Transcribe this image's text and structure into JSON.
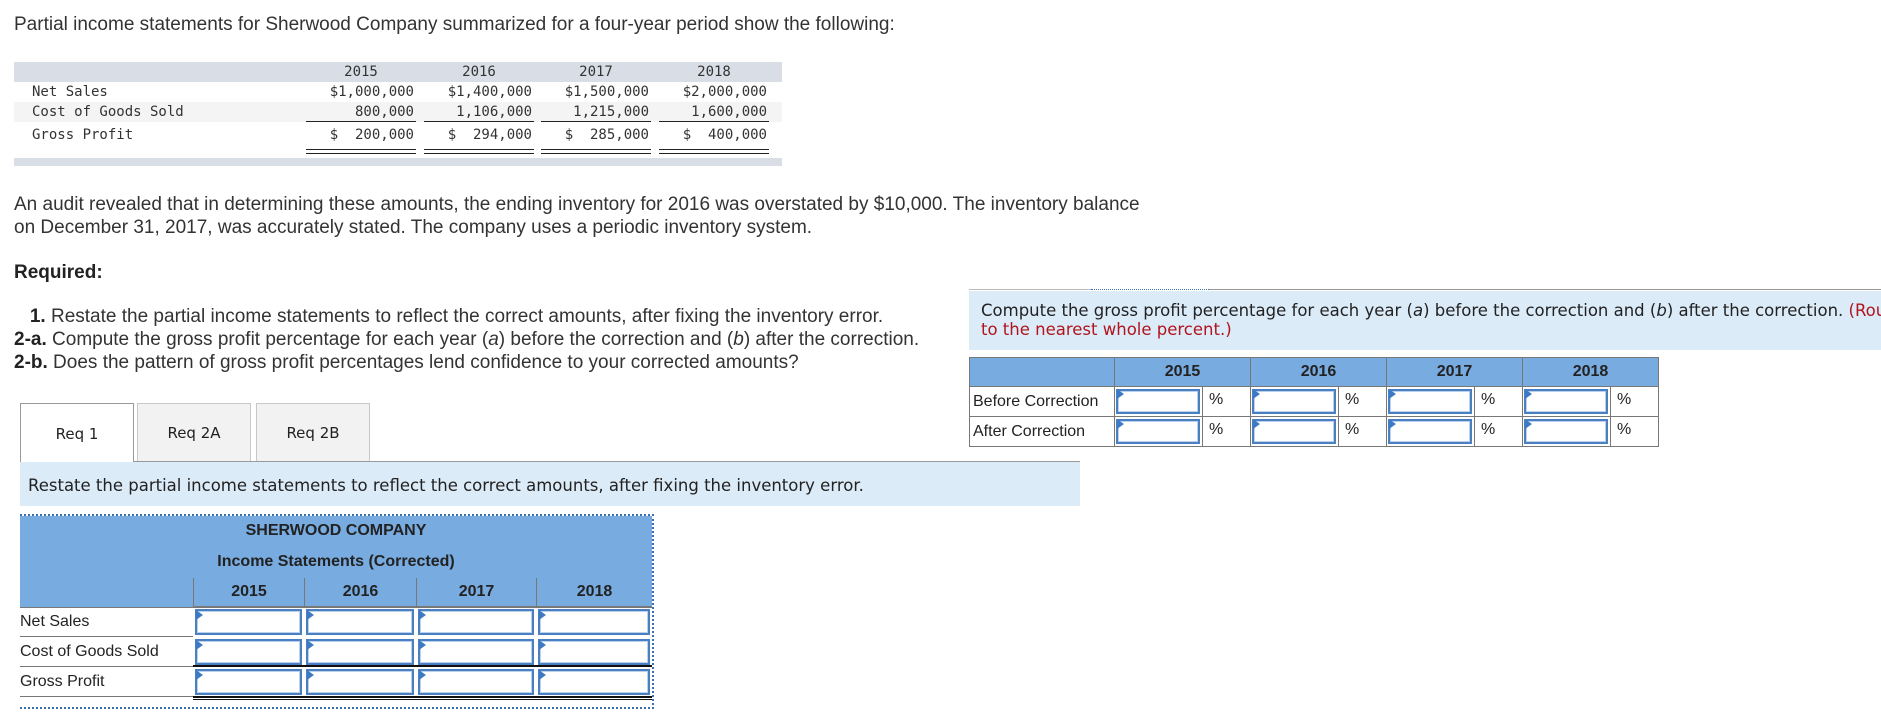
{
  "intro": "Partial income statements for Sherwood Company summarized for a four-year period show the following:",
  "given_table": {
    "years": [
      "2015",
      "2016",
      "2017",
      "2018"
    ],
    "rows": [
      {
        "label": "Net Sales",
        "values": [
          "$1,000,000",
          "$1,400,000",
          "$1,500,000",
          "$2,000,000"
        ]
      },
      {
        "label": "Cost of Goods Sold",
        "values": [
          "800,000",
          "1,106,000",
          "1,215,000",
          "1,600,000"
        ]
      },
      {
        "label": "Gross Profit",
        "values": [
          "$  200,000",
          "$  294,000",
          "$  285,000",
          "$  400,000"
        ]
      }
    ]
  },
  "audit_text_1": "An audit revealed that in determining these amounts, the ending inventory for 2016 was overstated by $10,000. The inventory balance",
  "audit_text_2": "on December 31, 2017, was accurately stated. The company uses a periodic inventory system.",
  "required_label": "Required:",
  "requirements": [
    {
      "num": "1.",
      "text": " Restate the partial income statements to reflect the correct amounts, after fixing the inventory error."
    },
    {
      "num": "2-a.",
      "text_1": " Compute the gross profit percentage for each year (",
      "a": "a",
      "text_2": ") before the correction and (",
      "b": "b",
      "text_3": ") after the correction."
    },
    {
      "num": "2-b.",
      "text": " Does the pattern of gross profit percentages lend confidence to your corrected amounts?"
    }
  ],
  "tabs": [
    {
      "label": "Req 1",
      "active": true
    },
    {
      "label": "Req 2A",
      "active": false
    },
    {
      "label": "Req 2B",
      "active": false
    }
  ],
  "req1": {
    "instruction": "Restate the partial income statements to reflect the correct amounts, after fixing the inventory error.",
    "company": "SHERWOOD COMPANY",
    "statement_title": "Income Statements (Corrected)",
    "years": [
      "2015",
      "2016",
      "2017",
      "2018"
    ],
    "rows": [
      {
        "label": "Net Sales",
        "values": [
          "",
          "",
          "",
          ""
        ]
      },
      {
        "label": "Cost of Goods Sold",
        "values": [
          "",
          "",
          "",
          ""
        ]
      },
      {
        "label": "Gross Profit",
        "values": [
          "",
          "",
          "",
          ""
        ]
      }
    ]
  },
  "req2a": {
    "instruction_1": "Compute the gross profit percentage for each year (",
    "a": "a",
    "instruction_2": ") before the correction and (",
    "b": "b",
    "instruction_3": ") after the correction. ",
    "note_1": "(Rou",
    "note_2": "to the nearest whole percent.)",
    "years": [
      "2015",
      "2016",
      "2017",
      "2018"
    ],
    "rows": [
      {
        "label": "Before Correction",
        "values": [
          "",
          "",
          "",
          ""
        ],
        "unit": "%"
      },
      {
        "label": "After Correction",
        "values": [
          "",
          "",
          "",
          ""
        ],
        "unit": "%"
      }
    ]
  },
  "colors": {
    "header_blue": "#78abe0",
    "band_blue": "#dcebf8",
    "note_red": "#b0151d",
    "input_border": "#4a7fc1"
  }
}
